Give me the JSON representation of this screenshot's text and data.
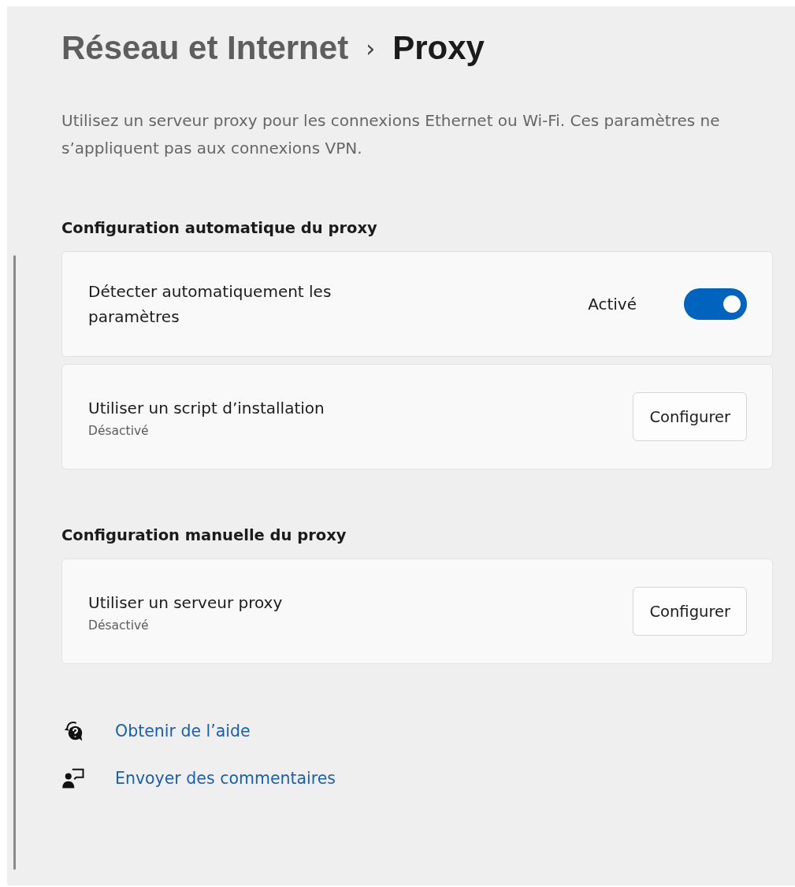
{
  "breadcrumb": {
    "parent": "Réseau et Internet",
    "separator": "›",
    "current": "Proxy"
  },
  "description": "Utilisez un serveur proxy pour les connexions Ethernet ou Wi-Fi. Ces paramètres ne s’appliquent pas aux connexions VPN.",
  "sections": [
    {
      "heading": "Configuration automatique du proxy",
      "cards": [
        {
          "kind": "toggle",
          "title": "Détecter automatiquement les paramètres",
          "state_label": "Activé",
          "on": true
        },
        {
          "kind": "button",
          "title": "Utiliser un script d’installation",
          "subtitle": "Désactivé",
          "button": "Configurer"
        }
      ]
    },
    {
      "heading": "Configuration manuelle du proxy",
      "cards": [
        {
          "kind": "button",
          "title": "Utiliser un serveur proxy",
          "subtitle": "Désactivé",
          "button": "Configurer"
        }
      ]
    }
  ],
  "links": [
    {
      "kind": "help",
      "label": "Obtenir de l’aide"
    },
    {
      "kind": "feedback",
      "label": "Envoyer des commentaires"
    }
  ]
}
